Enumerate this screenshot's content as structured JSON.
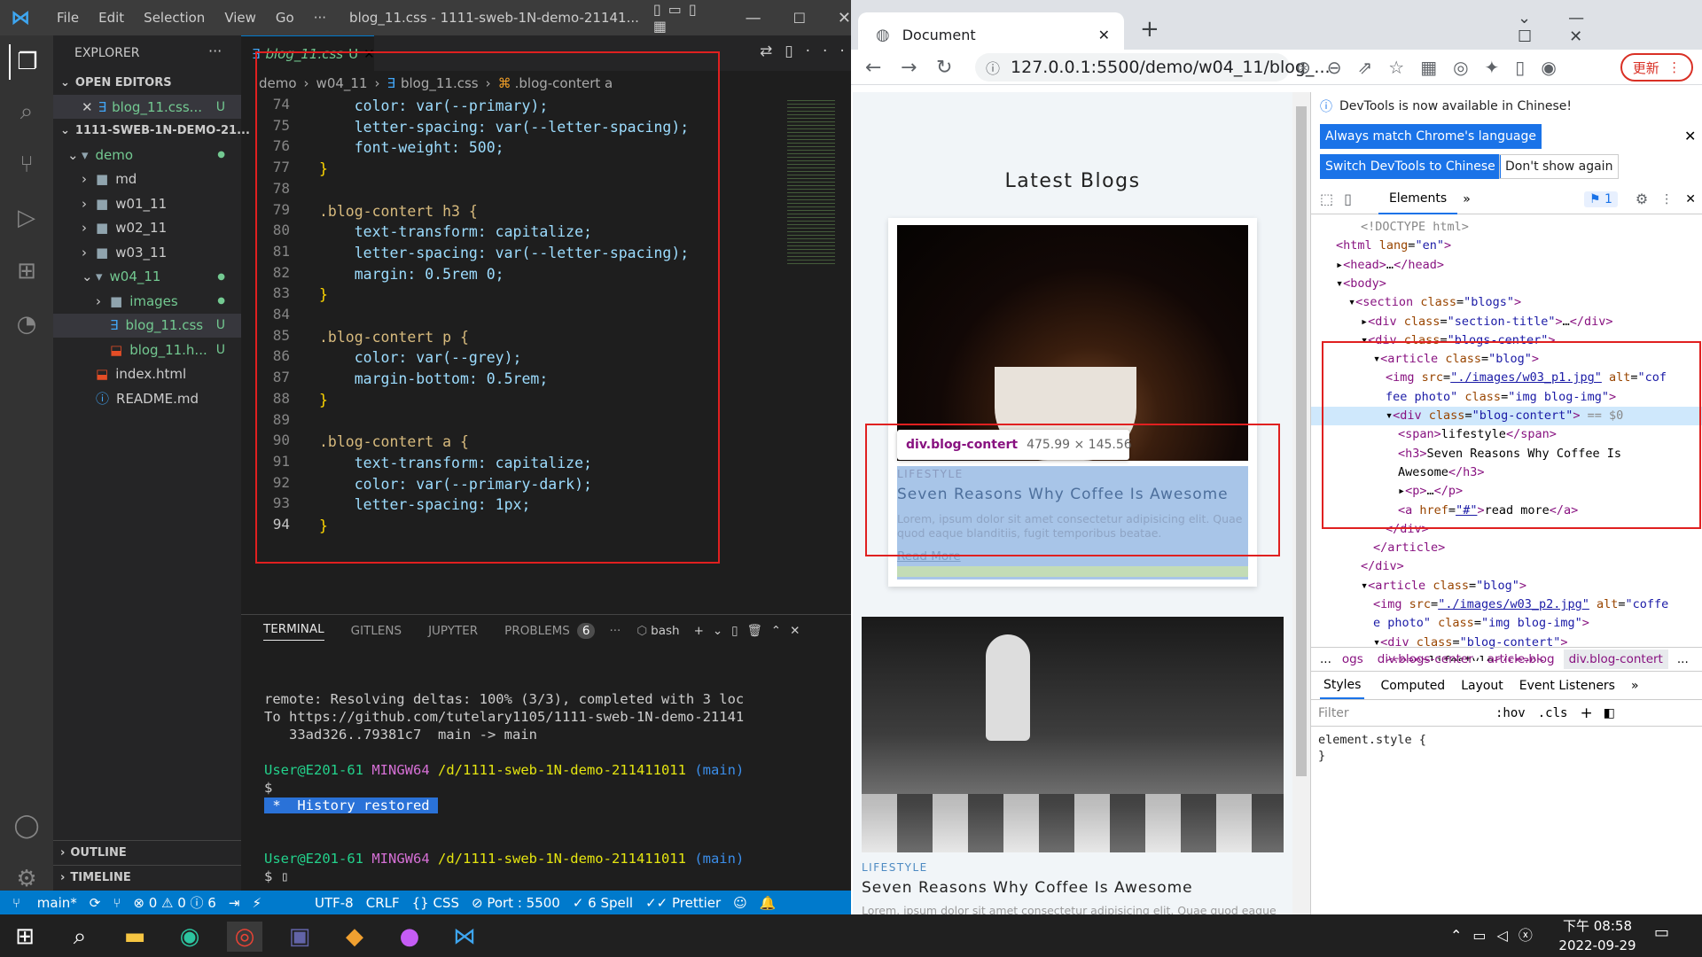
{
  "vscode": {
    "menu": [
      "File",
      "Edit",
      "Selection",
      "View",
      "Go",
      "···"
    ],
    "window_title": "blog_11.css - 1111-sweb-1N-demo-21141...",
    "explorer_title": "EXPLORER",
    "open_editors": "OPEN EDITORS",
    "open_file": "blog_11.css...",
    "root": "1111-SWEB-1N-DEMO-21...",
    "tree": [
      {
        "label": "demo",
        "indent": 1,
        "type": "folder-open",
        "color": "#73c991"
      },
      {
        "label": "md",
        "indent": 2,
        "type": "folder"
      },
      {
        "label": "w01_11",
        "indent": 2,
        "type": "folder"
      },
      {
        "label": "w02_11",
        "indent": 2,
        "type": "folder"
      },
      {
        "label": "w03_11",
        "indent": 2,
        "type": "folder"
      },
      {
        "label": "w04_11",
        "indent": 2,
        "type": "folder-open",
        "color": "#73c991"
      },
      {
        "label": "images",
        "indent": 3,
        "type": "folder",
        "color": "#73c991"
      },
      {
        "label": "blog_11.css",
        "indent": 3,
        "type": "css",
        "badge": "U",
        "color": "#73c991"
      },
      {
        "label": "blog_11.h...",
        "indent": 3,
        "type": "html",
        "badge": "U",
        "color": "#73c991"
      },
      {
        "label": "index.html",
        "indent": 2,
        "type": "html"
      },
      {
        "label": "README.md",
        "indent": 2,
        "type": "info"
      }
    ],
    "outline": "OUTLINE",
    "timeline": "TIMELINE",
    "tab_label": "blog_11.css",
    "tab_badge": "U",
    "breadcrumb": [
      "demo",
      "w04_11",
      "blog_11.css",
      ".blog-contert a"
    ],
    "code": [
      {
        "n": "74",
        "t": "    color: var(--primary);"
      },
      {
        "n": "75",
        "t": "    letter-spacing: var(--letter-spacing);"
      },
      {
        "n": "76",
        "t": "    font-weight: 500;"
      },
      {
        "n": "77",
        "t": "}"
      },
      {
        "n": "78",
        "t": ""
      },
      {
        "n": "79",
        "t": ".blog-contert h3 {"
      },
      {
        "n": "80",
        "t": "    text-transform: capitalize;"
      },
      {
        "n": "81",
        "t": "    letter-spacing: var(--letter-spacing);"
      },
      {
        "n": "82",
        "t": "    margin: 0.5rem 0;"
      },
      {
        "n": "83",
        "t": "}"
      },
      {
        "n": "84",
        "t": ""
      },
      {
        "n": "85",
        "t": ".blog-contert p {"
      },
      {
        "n": "86",
        "t": "    color: var(--grey);"
      },
      {
        "n": "87",
        "t": "    margin-bottom: 0.5rem;"
      },
      {
        "n": "88",
        "t": "}"
      },
      {
        "n": "89",
        "t": ""
      },
      {
        "n": "90",
        "t": ".blog-contert a {"
      },
      {
        "n": "91",
        "t": "    text-transform: capitalize;"
      },
      {
        "n": "92",
        "t": "    color: var(--primary-dark);"
      },
      {
        "n": "93",
        "t": "    letter-spacing: 1px;"
      },
      {
        "n": "94",
        "t": "}"
      }
    ],
    "panel_tabs": [
      "TERMINAL",
      "GITLENS",
      "JUPYTER",
      "PROBLEMS"
    ],
    "problems_count": "6",
    "shell": "bash",
    "terminal": [
      "remote: Resolving deltas: 100% (3/3), completed with 3 loc",
      "To https://github.com/tutelary1105/1111-sweb-1N-demo-21141",
      "   33ad326..79381c7  main -> main"
    ],
    "prompt_user": "User@E201-61",
    "prompt_env": "MINGW64",
    "prompt_path": "/d/1111-sweb-1N-demo-211411011",
    "prompt_branch": "(main)",
    "history_restored": " *  History restored ",
    "status": [
      "main*",
      "⟳",
      "⊗ 0 ⚠ 0 ⓘ 6",
      "UTF-8",
      "CRLF",
      "{} CSS",
      "⊘ Port : 5500",
      "✓ 6 Spell",
      "✓✓ Prettier"
    ]
  },
  "chrome": {
    "tab_title": "Document",
    "url": "127.0.0.1:5500/demo/w04_11/blog_...",
    "update_btn": "更新",
    "page": {
      "heading": "Latest Blogs",
      "tooltip_name": "div.blog-contert",
      "tooltip_size": "475.99 × 145.56",
      "card1": {
        "tag": "LIFESTYLE",
        "title": "Seven Reasons Why Coffee Is Awesome",
        "text": "Lorem, ipsum dolor sit amet consectetur adipisicing elit. Quae quod eaque blanditiis, fugit temporibus beatae.",
        "link": "Read More"
      },
      "card2": {
        "tag": "LIFESTYLE",
        "title": "Seven Reasons Why Coffee Is Awesome",
        "text": "Lorem, ipsum dolor sit amet consectetur adipisicing elit. Quae quod eaque"
      }
    },
    "devtools": {
      "info": "DevTools is now available in Chinese!",
      "btn_match": "Always match Chrome's language",
      "btn_switch": "Switch DevTools to Chinese",
      "btn_dont": "Don't show again",
      "elements_tab": "Elements",
      "issues": "1",
      "crumbs": [
        "...",
        "ogs",
        "div.blogs-center",
        "article.blog",
        "div.blog-contert",
        "..."
      ],
      "style_tabs": [
        "Styles",
        "Computed",
        "Layout",
        "Event Listeners",
        "»"
      ],
      "filter": "Filter",
      "hov": ":hov",
      "cls": ".cls",
      "element_style": "element.style {",
      "element_style_close": "}"
    }
  },
  "taskbar": {
    "time": "下午 08:58",
    "date": "2022-09-29"
  }
}
